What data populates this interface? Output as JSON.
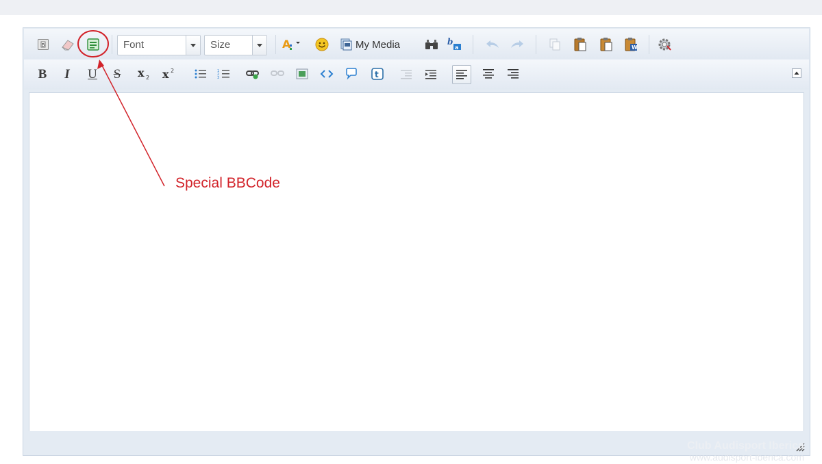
{
  "editor": {
    "font_select": {
      "value": "Font"
    },
    "size_select": {
      "value": "Size"
    },
    "my_media_label": "My Media",
    "format_buttons": {
      "bold": "B",
      "italic": "I",
      "underline": "U",
      "strike": "S"
    }
  },
  "annotation": {
    "label": "Special BBCode",
    "color": "#d2232a"
  },
  "watermark": {
    "line1": "Club Audisport Iberica",
    "line2": "www.audisport-iberica.com"
  },
  "icons": [
    "source-mode-icon",
    "eraser-icon",
    "special-bbcode-icon",
    "text-color-icon",
    "smiley-icon",
    "media-icon",
    "find-icon",
    "replace-icon",
    "undo-icon",
    "redo-icon",
    "copy-icon",
    "paste-icon",
    "paste-text-icon",
    "paste-word-icon",
    "settings-icon",
    "subscript-icon",
    "superscript-icon",
    "bullet-list-icon",
    "numbered-list-icon",
    "link-icon",
    "unlink-icon",
    "image-icon",
    "code-icon",
    "quote-icon",
    "twitter-icon",
    "outdent-icon",
    "indent-icon",
    "align-left-icon",
    "align-center-icon",
    "align-right-icon",
    "collapse-icon",
    "resize-grip-icon"
  ]
}
